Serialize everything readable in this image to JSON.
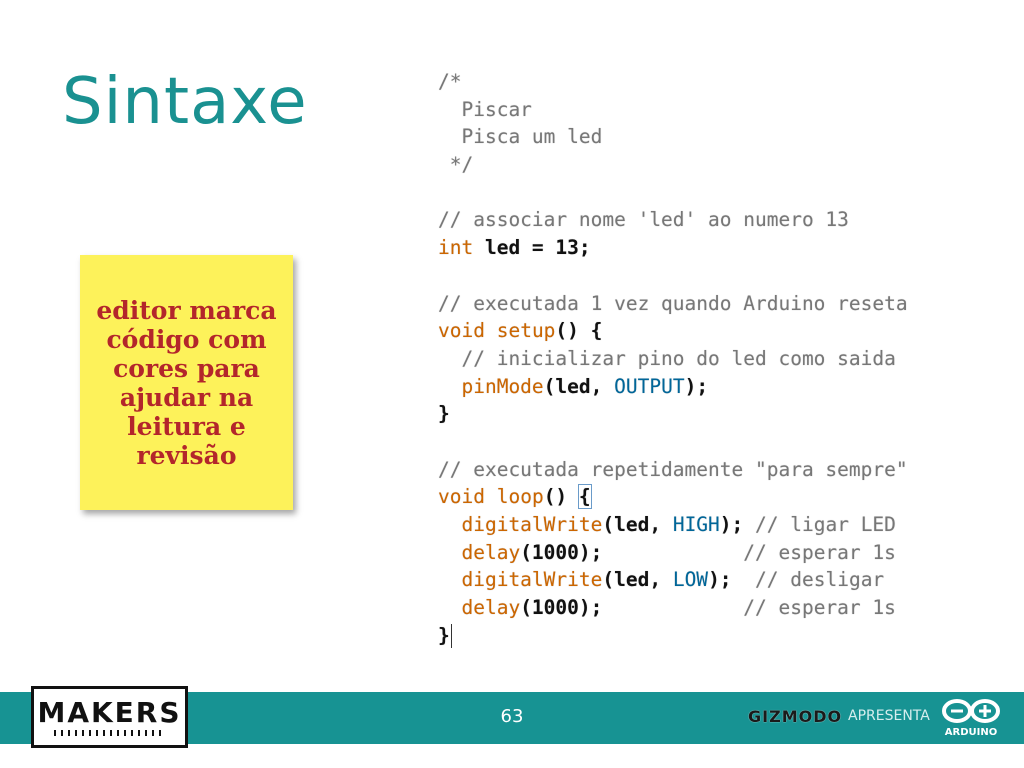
{
  "slide": {
    "title": "Sintaxe",
    "note": "editor marca\ncódigo com\ncores para\najudar na\nleitura e\nrevisão",
    "page_number": "63"
  },
  "code_lines": [
    [
      {
        "t": "/*",
        "c": "comment"
      }
    ],
    [
      {
        "t": "  Piscar",
        "c": "comment"
      }
    ],
    [
      {
        "t": "  Pisca um led",
        "c": "comment"
      }
    ],
    [
      {
        "t": " */",
        "c": "comment"
      }
    ],
    [],
    [
      {
        "t": "// associar nome 'led' ao numero 13",
        "c": "comment"
      }
    ],
    [
      {
        "t": "int",
        "c": "type"
      },
      {
        "t": " led = 13;",
        "c": "plain"
      }
    ],
    [],
    [
      {
        "t": "// executada 1 vez quando Arduino reseta",
        "c": "comment"
      }
    ],
    [
      {
        "t": "void",
        "c": "type"
      },
      {
        "t": " ",
        "c": "plain"
      },
      {
        "t": "setup",
        "c": "fn"
      },
      {
        "t": "() {",
        "c": "plain"
      }
    ],
    [
      {
        "t": "  // inicializar pino do led como saida",
        "c": "comment"
      }
    ],
    [
      {
        "t": "  ",
        "c": "plain"
      },
      {
        "t": "pinMode",
        "c": "fn"
      },
      {
        "t": "(led, ",
        "c": "plain"
      },
      {
        "t": "OUTPUT",
        "c": "const"
      },
      {
        "t": ");",
        "c": "plain"
      }
    ],
    [
      {
        "t": "}",
        "c": "plain"
      }
    ],
    [],
    [
      {
        "t": "// executada repetidamente \"para sempre\"",
        "c": "comment"
      }
    ],
    [
      {
        "t": "void",
        "c": "type"
      },
      {
        "t": " ",
        "c": "plain"
      },
      {
        "t": "loop",
        "c": "fn"
      },
      {
        "t": "() ",
        "c": "plain"
      },
      {
        "t": "{",
        "c": "plain",
        "box": true
      }
    ],
    [
      {
        "t": "  ",
        "c": "plain"
      },
      {
        "t": "digitalWrite",
        "c": "fn"
      },
      {
        "t": "(led, ",
        "c": "plain"
      },
      {
        "t": "HIGH",
        "c": "const"
      },
      {
        "t": "); ",
        "c": "plain"
      },
      {
        "t": "// ligar LED",
        "c": "comment"
      }
    ],
    [
      {
        "t": "  ",
        "c": "plain"
      },
      {
        "t": "delay",
        "c": "fn"
      },
      {
        "t": "(1000);            ",
        "c": "plain"
      },
      {
        "t": "// esperar 1s",
        "c": "comment"
      }
    ],
    [
      {
        "t": "  ",
        "c": "plain"
      },
      {
        "t": "digitalWrite",
        "c": "fn"
      },
      {
        "t": "(led, ",
        "c": "plain"
      },
      {
        "t": "LOW",
        "c": "const"
      },
      {
        "t": ");  ",
        "c": "plain"
      },
      {
        "t": "// desligar",
        "c": "comment"
      }
    ],
    [
      {
        "t": "  ",
        "c": "plain"
      },
      {
        "t": "delay",
        "c": "fn"
      },
      {
        "t": "(1000);            ",
        "c": "plain"
      },
      {
        "t": "// esperar 1s",
        "c": "comment"
      }
    ],
    [
      {
        "t": "}",
        "c": "plain",
        "caret": true
      }
    ]
  ],
  "footer": {
    "makers_logo": "MAKERS",
    "gizmodo": "GIZMODO",
    "apresenta": "APRESENTA",
    "arduino": "ARDUINO"
  },
  "colors": {
    "accent": "#1a9191",
    "footer_bg": "#179393",
    "note_bg": "#fdf25a",
    "note_text": "#b3262b",
    "code_comment": "#777777",
    "code_keyword": "#cc6600",
    "code_constant": "#006699"
  },
  "icons": {
    "makers": "makers-logo",
    "arduino": "arduino-infinity-logo"
  }
}
